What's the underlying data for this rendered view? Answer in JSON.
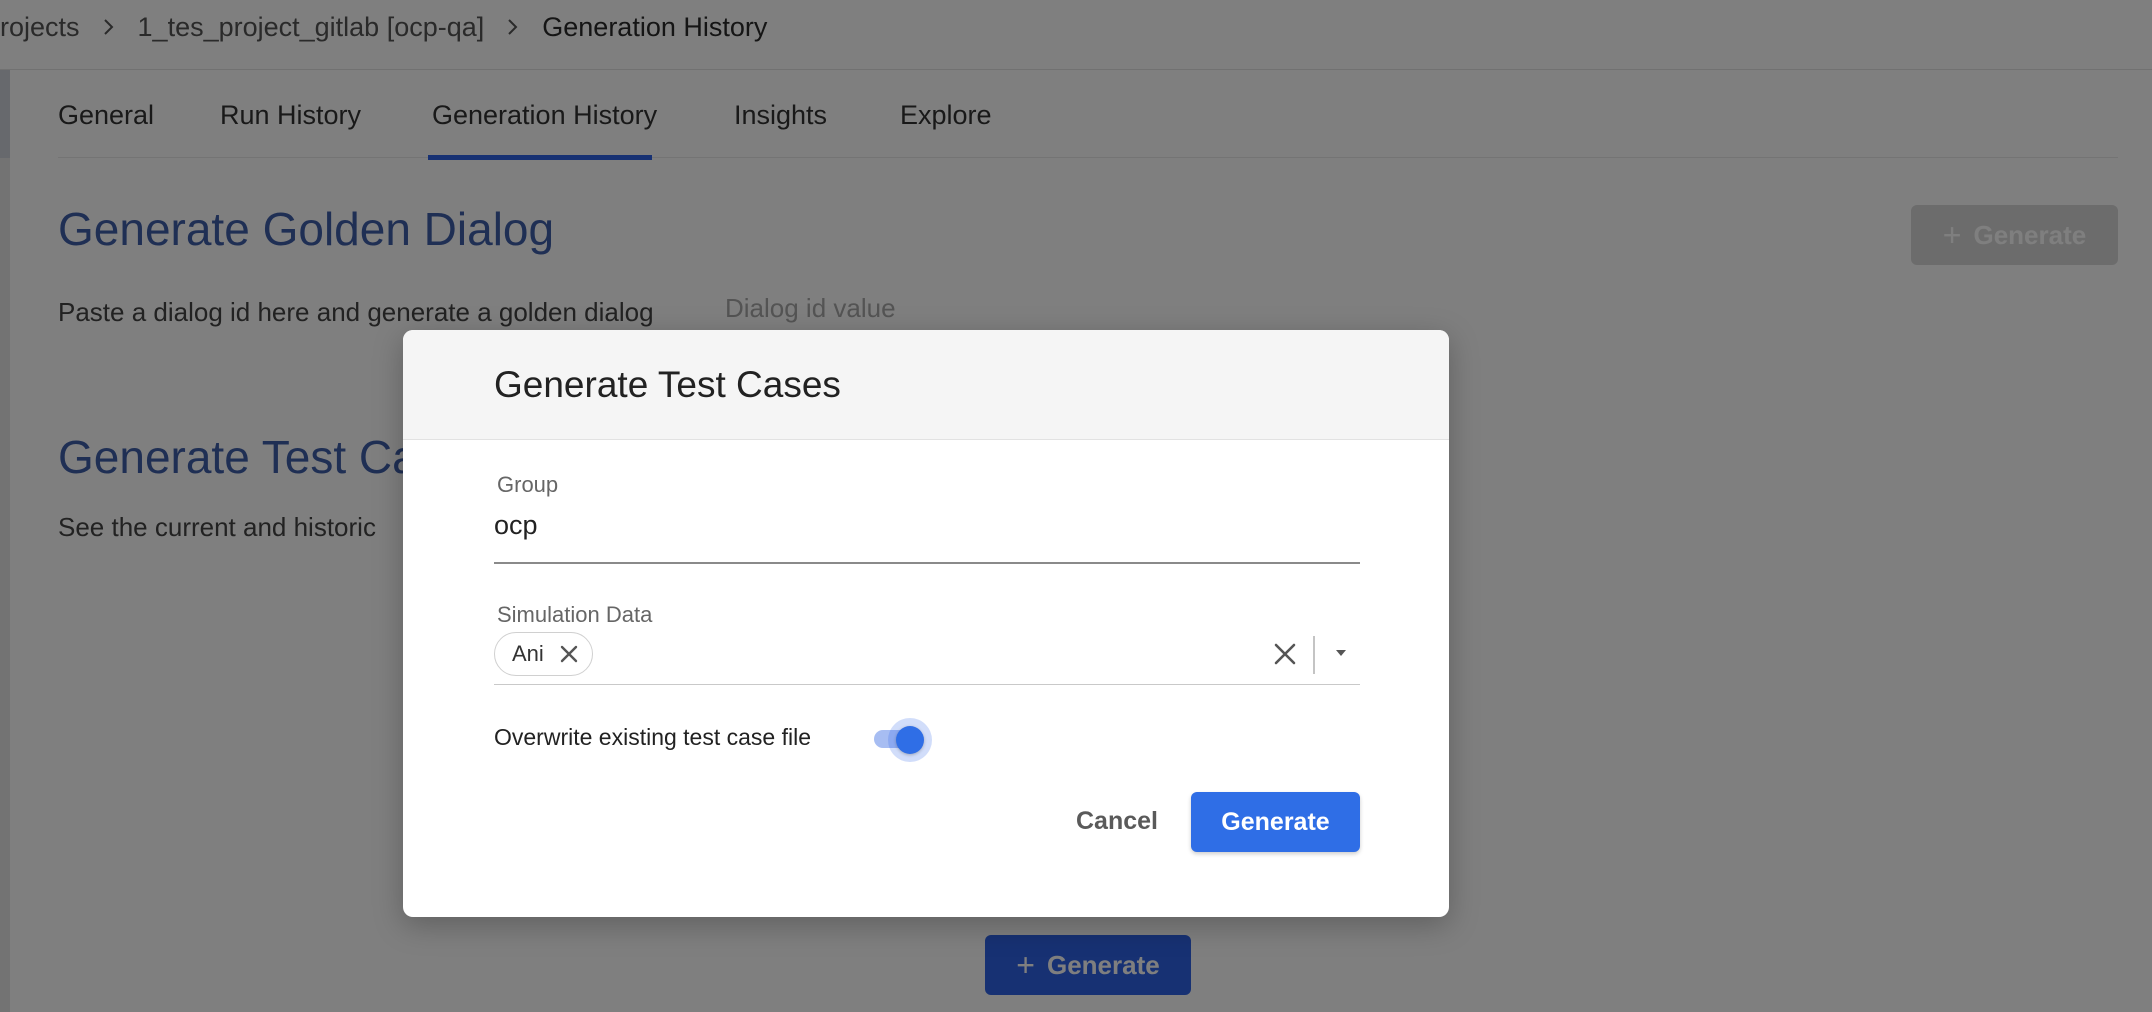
{
  "breadcrumb": {
    "items": [
      "rojects",
      "1_tes_project_gitlab [ocp-qa]",
      "Generation History"
    ]
  },
  "tabs": [
    {
      "label": "General",
      "active": false
    },
    {
      "label": "Run History",
      "active": false
    },
    {
      "label": "Generation History",
      "active": true
    },
    {
      "label": "Insights",
      "active": false
    },
    {
      "label": "Explore",
      "active": false
    }
  ],
  "golden_dialog": {
    "title": "Generate Golden Dialog",
    "description": "Paste a dialog id here and generate a golden dialog",
    "input_placeholder": "Dialog id value",
    "generate_label": "Generate"
  },
  "test_cases_section": {
    "title": "Generate Test Ca",
    "description": "See the current and historic",
    "generate_label": "Generate"
  },
  "modal": {
    "title": "Generate Test Cases",
    "group": {
      "label": "Group",
      "value": "ocp"
    },
    "simulation_data": {
      "label": "Simulation Data",
      "selected": [
        "Ani"
      ]
    },
    "overwrite": {
      "label": "Overwrite existing test case file",
      "enabled": true
    },
    "cancel_label": "Cancel",
    "confirm_label": "Generate"
  },
  "colors": {
    "accent": "#2f6ee6",
    "section_title": "#3f5ea8",
    "overlay": "rgba(0,0,0,0.5)"
  }
}
